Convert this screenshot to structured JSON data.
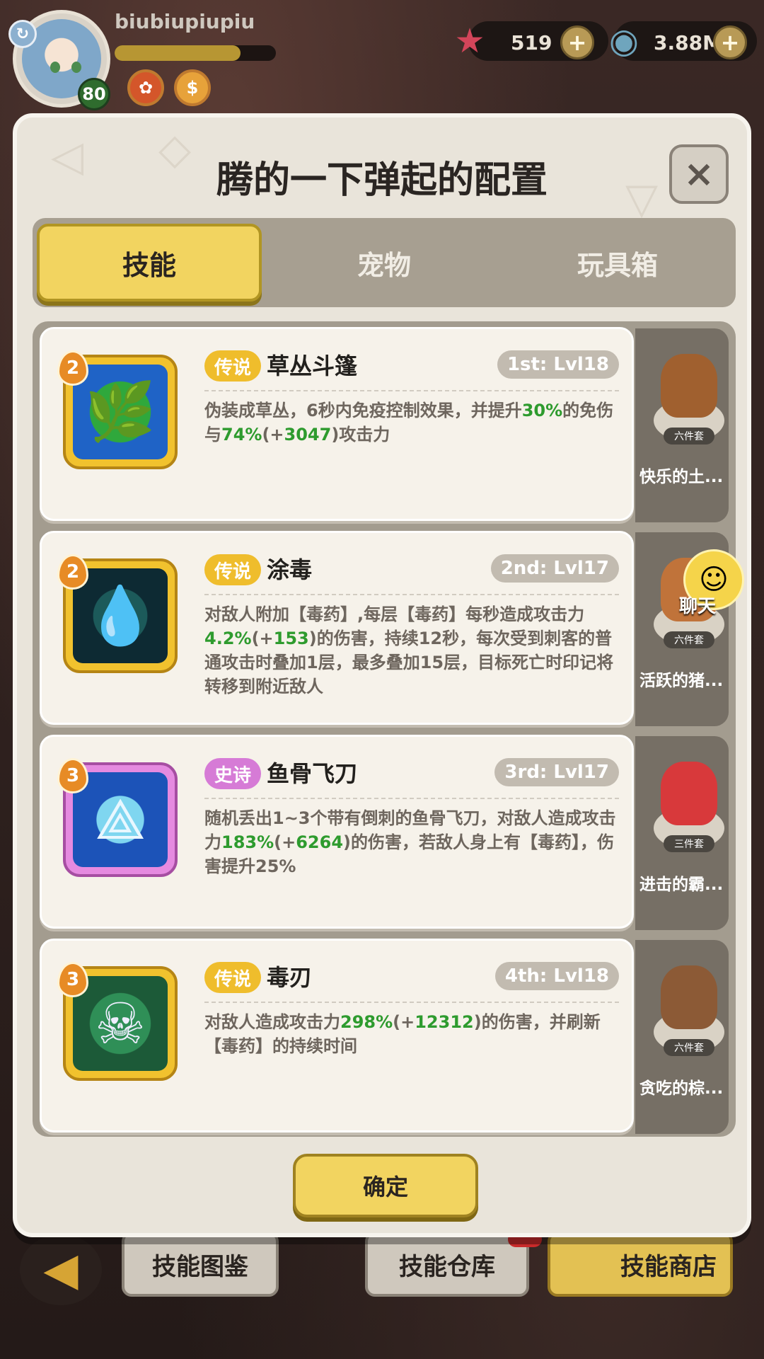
{
  "header": {
    "username": "biubiupiupiu",
    "level": "80",
    "exp_fraction": 0.78,
    "currencies": [
      {
        "icon": "starfish-icon",
        "value": "519"
      },
      {
        "icon": "shell-icon",
        "value": "3.88M"
      }
    ]
  },
  "dialog": {
    "title": "腾的一下弹起的配置",
    "close_label": "×",
    "tabs": [
      {
        "label": "技能",
        "active": true
      },
      {
        "label": "宠物",
        "active": false
      },
      {
        "label": "玩具箱",
        "active": false
      }
    ],
    "skills": [
      {
        "badge": "2",
        "rarity": "传说",
        "name": "草丛斗篷",
        "level": "1st: Lvl18",
        "desc_parts": [
          "伪装成草丛，6秒内免疫控制效果，并提升",
          "30%",
          "的免伤与",
          "74%",
          "(+",
          "3047",
          ")攻击力"
        ]
      },
      {
        "badge": "2",
        "rarity": "传说",
        "name": "涂毒",
        "level": "2nd: Lvl17",
        "desc_parts": [
          "对敌人附加【毒药】,每层【毒药】每秒造成攻击力",
          "4.2%",
          "(+",
          "153",
          ")的伤害，持续12秒，每次受到刺客的普通攻击时叠加1层，最多叠加15层，目标死亡时印记将转移到附近敌人"
        ]
      },
      {
        "badge": "3",
        "rarity": "史诗",
        "name": "鱼骨飞刀",
        "level": "3rd: Lvl17",
        "desc_parts": [
          "随机丢出1~3个带有倒刺的鱼骨飞刀，对敌人造成攻击力",
          "183%",
          "(+",
          "6264",
          ")的伤害，若敌人身上有【毒药】，伤害提升25%"
        ]
      },
      {
        "badge": "3",
        "rarity": "传说",
        "name": "毒刃",
        "level": "4th: Lvl18",
        "desc_parts": [
          "对敌人造成攻击力",
          "298%",
          "(+",
          "12312",
          ")的伤害，并刷新【毒药】的持续时间"
        ]
      }
    ],
    "pets": [
      {
        "tag": "六件套",
        "name": "快乐的土..."
      },
      {
        "tag": "六件套",
        "name": "活跃的猪..."
      },
      {
        "tag": "三件套",
        "name": "进击的霸..."
      },
      {
        "tag": "六件套",
        "name": "贪吃的棕..."
      }
    ],
    "chat_label": "聊天",
    "confirm_label": "确定"
  },
  "bottom_bar": {
    "buttons": [
      "技能图鉴",
      "技能仓库",
      "技能商店"
    ]
  },
  "colors": {
    "legend": "#efbd2c",
    "epic": "#d67bd6",
    "highlight_green": "#2e9b2e"
  }
}
